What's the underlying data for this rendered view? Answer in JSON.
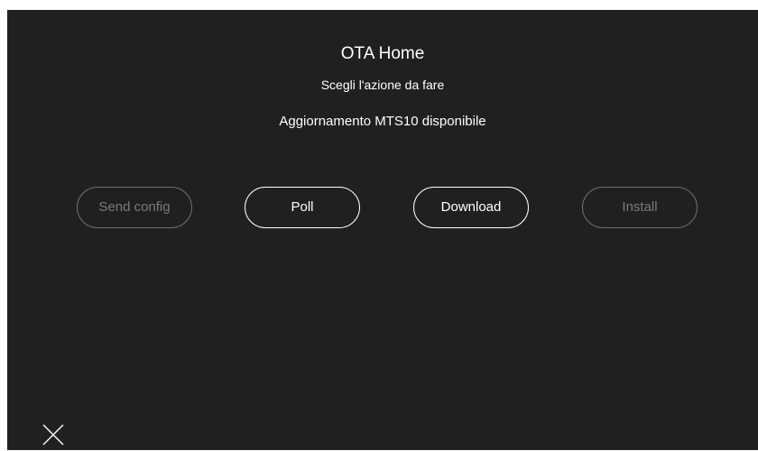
{
  "header": {
    "title": "OTA Home",
    "subtitle": "Scegli l'azione da fare"
  },
  "status": {
    "message": "Aggiornamento MTS10 disponibile"
  },
  "actions": [
    {
      "label": "Send config",
      "enabled": false
    },
    {
      "label": "Poll",
      "enabled": true
    },
    {
      "label": "Download",
      "enabled": true
    },
    {
      "label": "Install",
      "enabled": false
    }
  ],
  "footer": {
    "close_icon": "close-icon"
  },
  "colors": {
    "background": "#202020",
    "text": "#ffffff",
    "disabled": "#7a7a7a"
  }
}
